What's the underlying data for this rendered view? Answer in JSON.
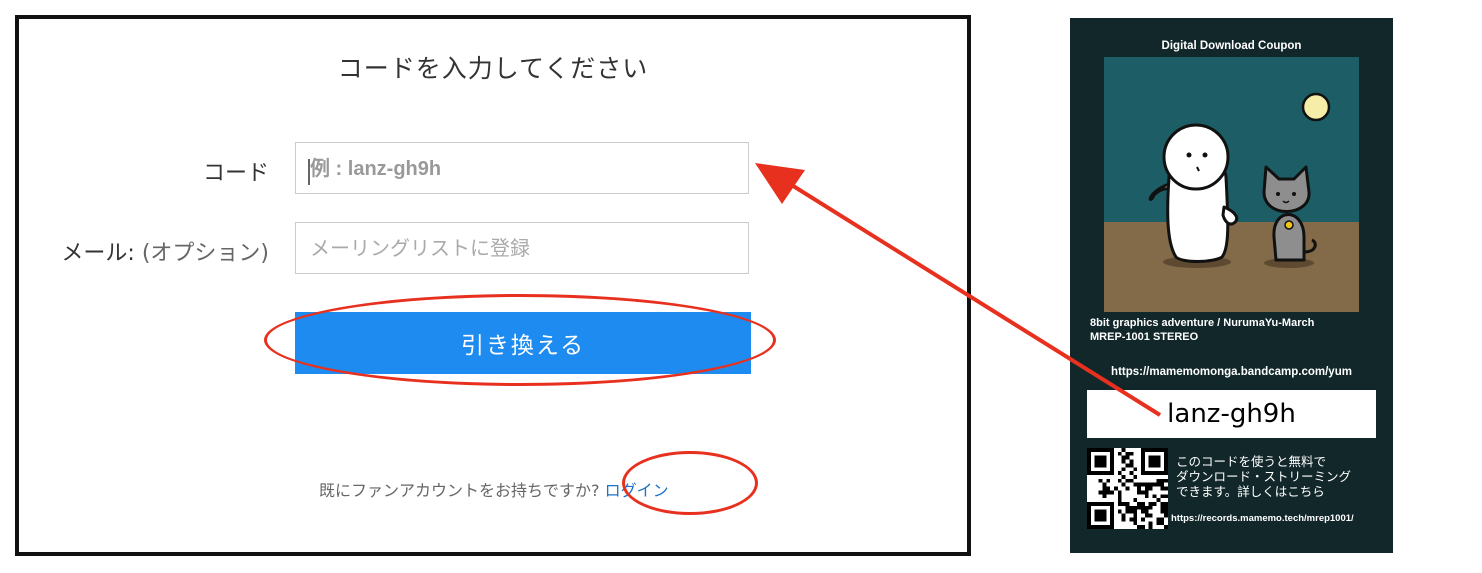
{
  "form": {
    "title": "コードを入力してください",
    "code_label": "コード",
    "code_placeholder": "例 : lanz-gh9h",
    "email_label": "メール:",
    "email_label_optional": "(オプション)",
    "email_placeholder": "メーリングリストに登録",
    "redeem_button": "引き換える",
    "footer_text": "既にファンアカウントをお持ちですか?",
    "login_link": "ログイン"
  },
  "coupon": {
    "title": "Digital Download Coupon",
    "album_line": "8bit graphics adventure / NurumaYu-March",
    "catalog_line": "MREP-1001 STEREO",
    "bandcamp_url": "https://mamemomonga.bandcamp.com/yum",
    "code": "lanz-gh9h",
    "description_line1": "このコードを使うと無料で",
    "description_line2": "ダウンロード・ストリーミング",
    "description_line3": "できます。詳しくはこちら",
    "records_url": "https://records.mamemo.tech/mrep1001/"
  },
  "colors": {
    "button": "#1e8bf0",
    "highlight": "#e8301e",
    "card_background": "#11272a",
    "link": "#1a73c8"
  }
}
